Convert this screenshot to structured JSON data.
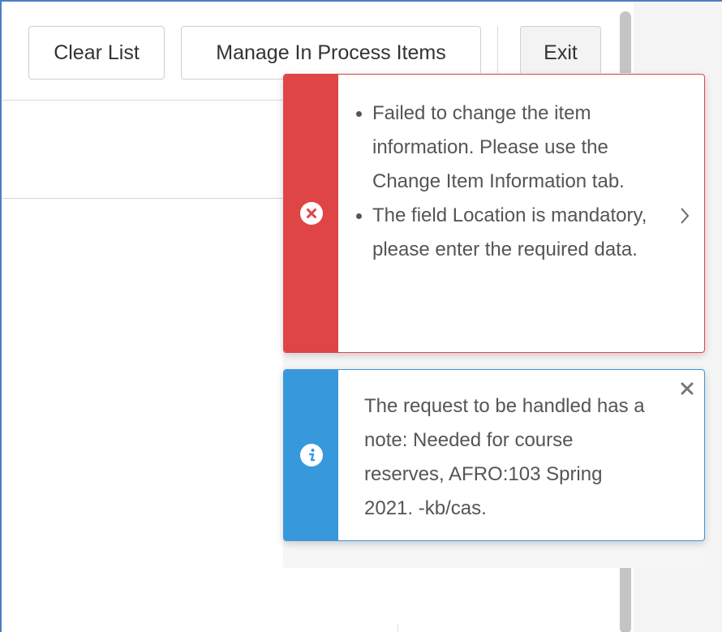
{
  "toolbar": {
    "clear_list_label": "Clear List",
    "manage_label": "Manage In Process Items",
    "exit_label": "Exit"
  },
  "error_toast": {
    "icon": "error-circle-x-icon",
    "messages": [
      "Failed to change the item information. Please use the Change Item Information tab.",
      "The field Location is mandatory, please enter the required data."
    ],
    "expand_icon": "chevron-right-icon",
    "color": "#e04545"
  },
  "info_toast": {
    "icon": "info-circle-icon",
    "message": "The request to be handled has a note: Needed for course reserves, AFRO:103 Spring 2021. -kb/cas.",
    "close_icon": "close-icon",
    "color": "#3898dc"
  }
}
